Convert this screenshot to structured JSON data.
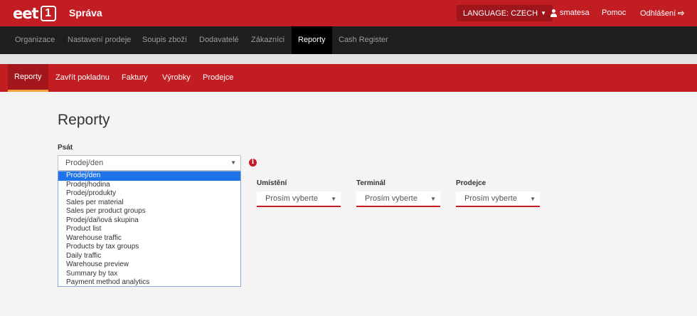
{
  "header": {
    "logo_text": "eet",
    "logo_number": "1",
    "app_title": "Správa",
    "language_label": "LANGUAGE: CZECH",
    "user_label": "smatesa",
    "help_label": "Pomoc",
    "logout_label": "Odhlášení"
  },
  "main_nav": {
    "items": [
      "Organizace",
      "Nastavení prodeje",
      "Soupis zboží",
      "Dodavatelé",
      "Zákazníci",
      "Reporty",
      "Cash Register"
    ],
    "active": "Reporty"
  },
  "sub_nav": {
    "items": [
      "Reporty",
      "Zavřít pokladnu",
      "Faktury",
      "Výrobky",
      "Prodejce"
    ],
    "active": "Reporty"
  },
  "content": {
    "title": "Reporty",
    "psat_label": "Psát",
    "psat_value": "Prodej/den",
    "dropdown_options": [
      "Prodej/den",
      "Prodej/hodina",
      "Prodej/produkty",
      "Sales per material",
      "Sales per product groups",
      "Prodej/daňová skupina",
      "Product list",
      "Warehouse traffic",
      "Products by tax groups",
      "Daily traffic",
      "Warehouse preview",
      "Summary by tax",
      "Payment method analytics"
    ],
    "filters": [
      {
        "label": "Umístění",
        "value": "Prosím vyberte"
      },
      {
        "label": "Terminál",
        "value": "Prosím vyberte"
      },
      {
        "label": "Prodejce",
        "value": "Prosím vyberte"
      }
    ]
  },
  "colors": {
    "brand_red": "#c31d24",
    "dark_nav": "#1f1f1f",
    "selection_blue": "#1e73e8"
  }
}
